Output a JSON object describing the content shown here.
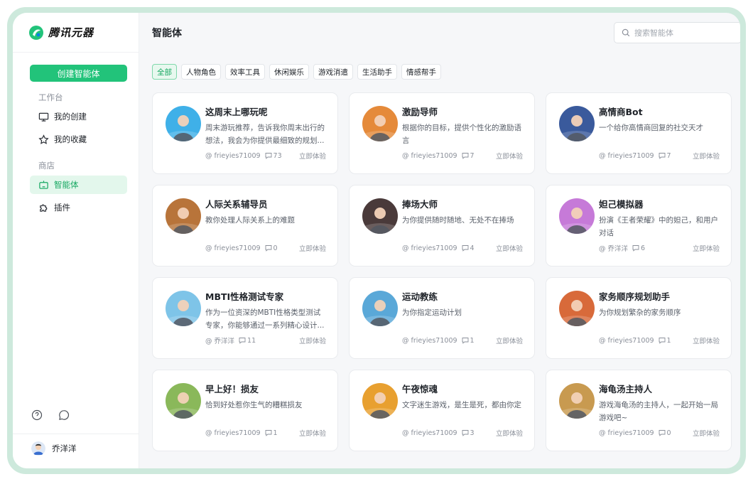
{
  "app": {
    "name": "腾讯元器"
  },
  "sidebar": {
    "create_label": "创建智能体",
    "section_workbench": "工作台",
    "section_store": "商店",
    "items": [
      {
        "label": "我的创建",
        "icon": "monitor-icon"
      },
      {
        "label": "我的收藏",
        "icon": "star-icon"
      },
      {
        "label": "智能体",
        "icon": "robot-icon"
      },
      {
        "label": "插件",
        "icon": "puzzle-icon"
      }
    ],
    "user_name": "乔洋洋"
  },
  "header": {
    "title": "智能体",
    "search_placeholder": "搜索智能体"
  },
  "tabs": [
    {
      "label": "全部",
      "active": true
    },
    {
      "label": "人物角色"
    },
    {
      "label": "效率工具"
    },
    {
      "label": "休闲娱乐"
    },
    {
      "label": "游戏消遣"
    },
    {
      "label": "生活助手"
    },
    {
      "label": "情感帮手"
    }
  ],
  "try_label": "立即体验",
  "cards": [
    {
      "title": "这周末上哪玩呢",
      "desc": "周末游玩推荐，告诉我你周末出行的想法，我会为你提供最细致的规划...",
      "author": "@ frieyies71009",
      "comments": "73",
      "avatar_color": "#3fb0e8"
    },
    {
      "title": "激励导师",
      "desc": "根据你的目标，提供个性化的激励语言",
      "author": "@ frieyies71009",
      "comments": "7",
      "avatar_color": "#e58a3a"
    },
    {
      "title": "高情商Bot",
      "desc": "一个给你高情商回复的社交天才",
      "author": "@ frieyies71009",
      "comments": "7",
      "avatar_color": "#3a5a9c"
    },
    {
      "title": "人际关系辅导员",
      "desc": "教你处理人际关系上的难题",
      "author": "@ frieyies71009",
      "comments": "0",
      "avatar_color": "#b8743a"
    },
    {
      "title": "捧场大师",
      "desc": "为你提供随时随地、无处不在捧场",
      "author": "@ frieyies71009",
      "comments": "4",
      "avatar_color": "#4a3a3a"
    },
    {
      "title": "妲己模拟器",
      "desc": "扮演《王者荣耀》中的妲己，和用户对话",
      "author": "@ 乔洋洋",
      "comments": "6",
      "avatar_color": "#c67ad8"
    },
    {
      "title": "MBTI性格测试专家",
      "desc": "作为一位资深的MBTI性格类型测试专家，你能够通过一系列精心设计...",
      "author": "@ 乔洋洋",
      "comments": "11",
      "avatar_color": "#7ec4e8"
    },
    {
      "title": "运动教练",
      "desc": "为你指定运动计划",
      "author": "@ frieyies71009",
      "comments": "1",
      "avatar_color": "#5aa8d8"
    },
    {
      "title": "家务顺序规划助手",
      "desc": "为你规划繁杂的家务顺序",
      "author": "@ frieyies71009",
      "comments": "1",
      "avatar_color": "#d86a3a"
    },
    {
      "title": "早上好！损友",
      "desc": "恰到好处惹你生气的糟糕损友",
      "author": "@ frieyies71009",
      "comments": "1",
      "avatar_color": "#8ab85a"
    },
    {
      "title": "午夜惊魂",
      "desc": "文字迷生游戏，是生是死，都由你定",
      "author": "@ frieyies71009",
      "comments": "3",
      "avatar_color": "#e8a030"
    },
    {
      "title": "海龟汤主持人",
      "desc": "游戏海龟汤的主持人，一起开始一局游戏吧~",
      "author": "@ frieyies71009",
      "comments": "0",
      "avatar_color": "#c89a50"
    }
  ]
}
